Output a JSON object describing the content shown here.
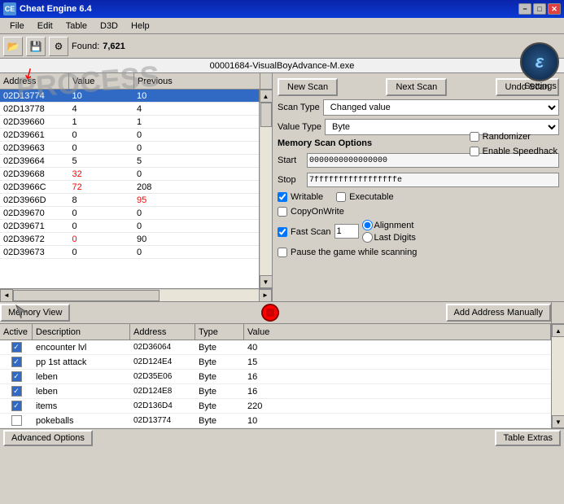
{
  "titleBar": {
    "title": "Cheat Engine 6.4",
    "minimizeLabel": "−",
    "maximizeLabel": "□",
    "closeLabel": "✕"
  },
  "menuBar": {
    "items": [
      "File",
      "Edit",
      "Table",
      "D3D",
      "Help"
    ]
  },
  "toolbar": {
    "foundLabel": "Found:",
    "foundValue": "7,621"
  },
  "addressBar": {
    "text": "00001684-VisualBoyAdvance-M.exe"
  },
  "scanPanel": {
    "columns": [
      "Address",
      "Value",
      "Previous"
    ],
    "rows": [
      {
        "address": "02D13774",
        "value": "10",
        "previous": "10",
        "selected": true,
        "valueColor": "normal",
        "prevColor": "normal"
      },
      {
        "address": "02D13778",
        "value": "4",
        "previous": "4",
        "selected": false,
        "valueColor": "normal",
        "prevColor": "normal"
      },
      {
        "address": "02D39660",
        "value": "1",
        "previous": "1",
        "selected": false,
        "valueColor": "normal",
        "prevColor": "normal"
      },
      {
        "address": "02D39661",
        "value": "0",
        "previous": "0",
        "selected": false,
        "valueColor": "normal",
        "prevColor": "normal"
      },
      {
        "address": "02D39663",
        "value": "0",
        "previous": "0",
        "selected": false,
        "valueColor": "normal",
        "prevColor": "normal"
      },
      {
        "address": "02D39664",
        "value": "5",
        "previous": "5",
        "selected": false,
        "valueColor": "normal",
        "prevColor": "normal"
      },
      {
        "address": "02D39668",
        "value": "32",
        "previous": "0",
        "selected": false,
        "valueColor": "red",
        "prevColor": "normal"
      },
      {
        "address": "02D3966C",
        "value": "72",
        "previous": "208",
        "selected": false,
        "valueColor": "red",
        "prevColor": "normal"
      },
      {
        "address": "02D3966D",
        "value": "8",
        "previous": "95",
        "selected": false,
        "valueColor": "normal",
        "prevColor": "red"
      },
      {
        "address": "02D39670",
        "value": "0",
        "previous": "0",
        "selected": false,
        "valueColor": "normal",
        "prevColor": "normal"
      },
      {
        "address": "02D39671",
        "value": "0",
        "previous": "0",
        "selected": false,
        "valueColor": "normal",
        "prevColor": "normal"
      },
      {
        "address": "02D39672",
        "value": "0",
        "previous": "90",
        "selected": false,
        "valueColor": "red",
        "prevColor": "normal"
      },
      {
        "address": "02D39673",
        "value": "0",
        "previous": "0",
        "selected": false,
        "valueColor": "normal",
        "prevColor": "normal"
      }
    ]
  },
  "rightPanel": {
    "newScanLabel": "New Scan",
    "nextScanLabel": "Next Scan",
    "undoScanLabel": "Undo Scan",
    "settingsLabel": "Settings",
    "scanTypeLabel": "Scan Type",
    "scanTypeValue": "Changed value",
    "valueTypeLabel": "Value Type",
    "valueTypeValue": "Byte",
    "memoryScanLabel": "Memory Scan Options",
    "startLabel": "Start",
    "startValue": "0000000000000000",
    "stopLabel": "Stop",
    "stopValue": "7fffffffffffffffffe",
    "writableLabel": "Writable",
    "executableLabel": "Executable",
    "copyOnWriteLabel": "CopyOnWrite",
    "fastScanLabel": "Fast Scan",
    "fastScanValue": "1",
    "alignmentLabel": "Alignment",
    "lastDigitsLabel": "Last Digits",
    "pauseLabel": "Pause the game while scanning",
    "randomizerLabel": "Randomizer",
    "speedhackLabel": "Enable Speedhack"
  },
  "bottomToolbar": {
    "memoryViewLabel": "Memory View",
    "addAddressLabel": "Add Address Manually"
  },
  "addressTable": {
    "columns": [
      "Active",
      "Description",
      "Address",
      "Type",
      "Value"
    ],
    "rows": [
      {
        "active": true,
        "description": "encounter lvl",
        "address": "02D36064",
        "type": "Byte",
        "value": "40"
      },
      {
        "active": true,
        "description": "pp 1st attack",
        "address": "02D124E4",
        "type": "Byte",
        "value": "15"
      },
      {
        "active": true,
        "description": "leben",
        "address": "02D35E06",
        "type": "Byte",
        "value": "16"
      },
      {
        "active": true,
        "description": "leben",
        "address": "02D124E8",
        "type": "Byte",
        "value": "16"
      },
      {
        "active": true,
        "description": "items",
        "address": "02D136D4",
        "type": "Byte",
        "value": "220"
      },
      {
        "active": false,
        "description": "pokeballs",
        "address": "02D13774",
        "type": "Byte",
        "value": "10"
      }
    ]
  },
  "statusBar": {
    "advancedOptionsLabel": "Advanced Options",
    "tableExtrasLabel": "Table Extras"
  },
  "watermark": "PROCESS"
}
